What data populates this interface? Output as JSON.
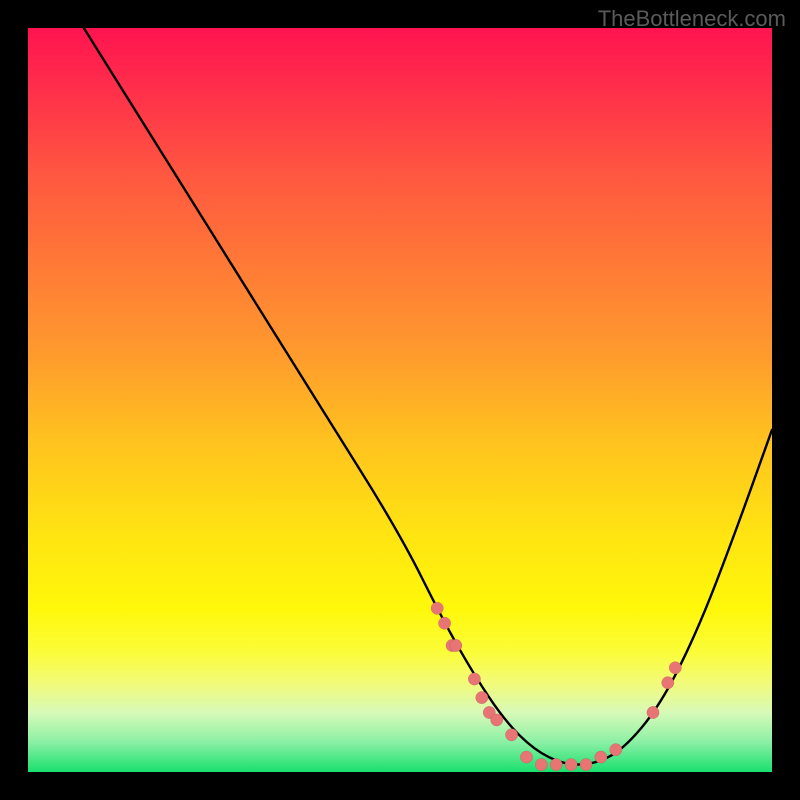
{
  "watermark": "TheBottleneck.com",
  "chart_data": {
    "type": "line",
    "title": "",
    "xlabel": "",
    "ylabel": "",
    "xlim": [
      0,
      100
    ],
    "ylim": [
      0,
      100
    ],
    "grid": false,
    "legend": false,
    "series": [
      {
        "name": "curve",
        "color": "#000000",
        "x": [
          0,
          10,
          20,
          30,
          40,
          50,
          56,
          60,
          64,
          68,
          72,
          76,
          80,
          85,
          90,
          95,
          100
        ],
        "y": [
          112,
          96,
          80,
          64,
          48,
          32,
          20,
          13,
          7,
          3,
          1,
          1,
          3,
          9,
          19,
          32,
          46
        ]
      }
    ],
    "markers": {
      "name": "points",
      "color": "#e87474",
      "x": [
        55,
        56,
        57,
        57.5,
        60,
        61,
        62,
        63,
        65,
        67,
        69,
        71,
        73,
        75,
        77,
        79,
        84,
        86,
        87
      ],
      "y": [
        22,
        20,
        17,
        17,
        12.5,
        10,
        8,
        7,
        5,
        2,
        1,
        1,
        1,
        1,
        2,
        3,
        8,
        12,
        14
      ]
    },
    "gradient": {
      "stops": [
        {
          "pct": 0,
          "color": "#ff1450"
        },
        {
          "pct": 20,
          "color": "#ff5840"
        },
        {
          "pct": 44,
          "color": "#ff9b2d"
        },
        {
          "pct": 68,
          "color": "#ffe412"
        },
        {
          "pct": 88,
          "color": "#f2fb78"
        },
        {
          "pct": 100,
          "color": "#19e06e"
        }
      ]
    }
  }
}
